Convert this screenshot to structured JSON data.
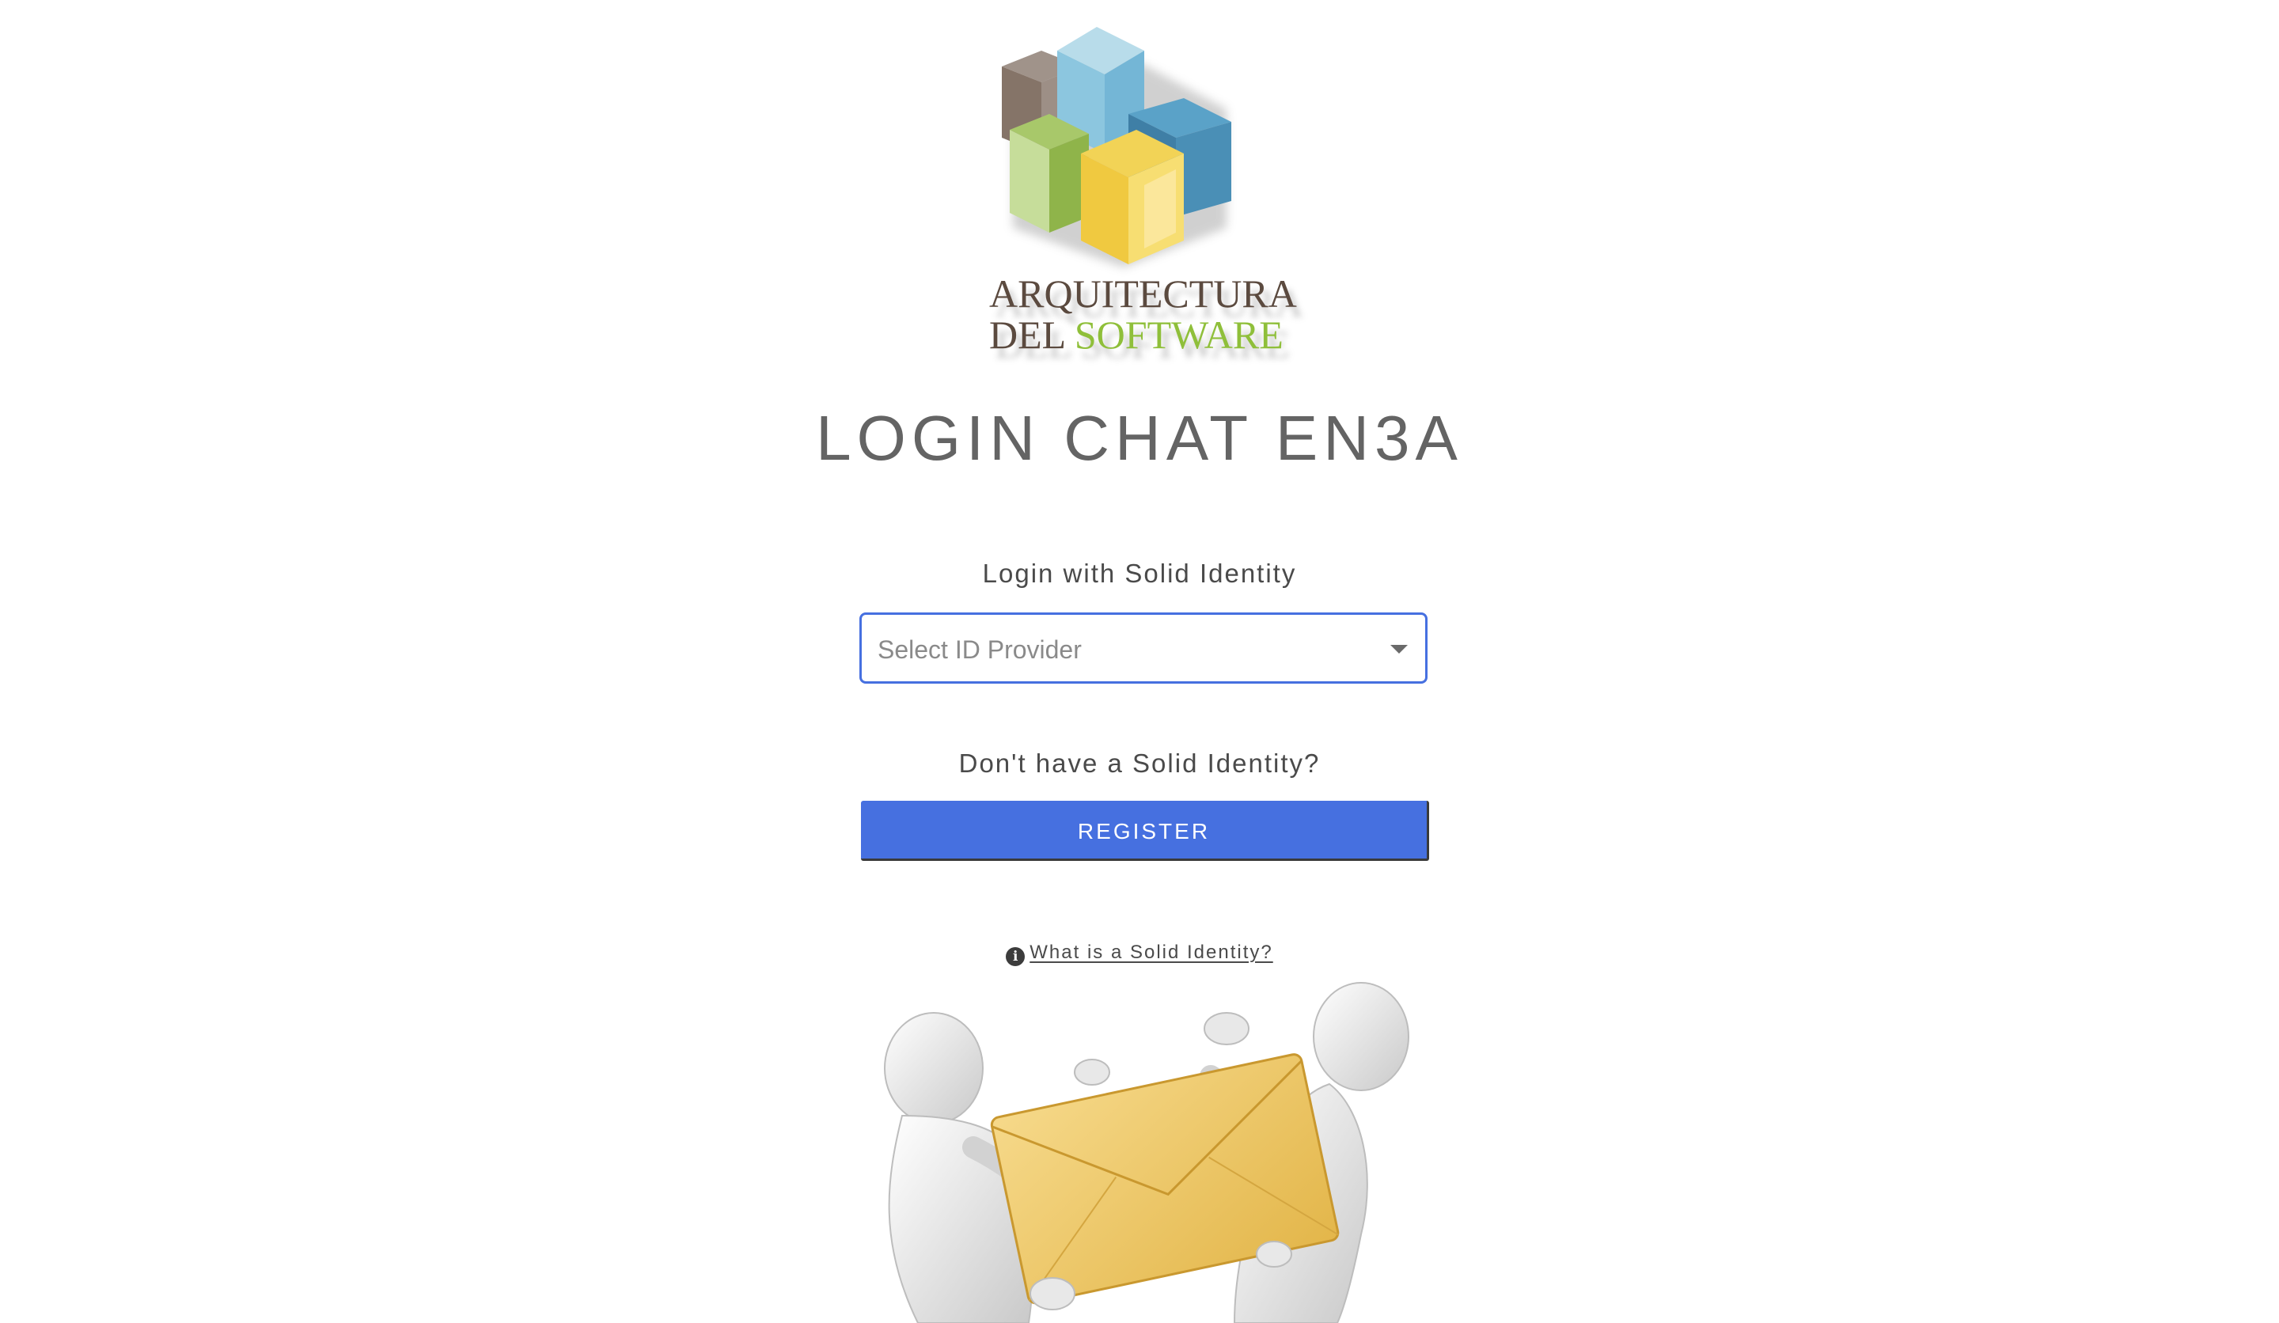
{
  "logo": {
    "line1": "ARQUITECTURA",
    "line2_prefix": "DEL ",
    "line2_accent": "SOFTWARE",
    "icon": "stacked-cubes-logo",
    "accent_color": "#8fbf3a"
  },
  "page_title": "LOGIN CHAT EN3A",
  "login": {
    "heading": "Login with Solid Identity",
    "select_placeholder": "Select ID Provider"
  },
  "register": {
    "heading": "Don't have a Solid Identity?",
    "button_label": "REGISTER"
  },
  "help": {
    "icon": "info-icon",
    "link_text": "What is a Solid Identity?"
  },
  "illustration": {
    "icon": "two-figures-carrying-envelope"
  },
  "colors": {
    "primary": "#4670e0",
    "title": "#646464",
    "text": "#4a4a4a",
    "background": "#ffffff"
  }
}
